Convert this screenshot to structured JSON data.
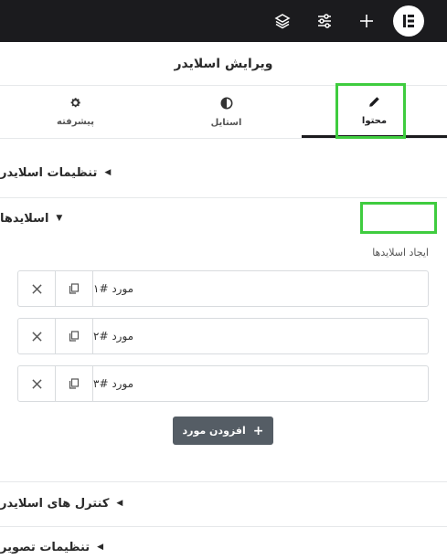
{
  "topbar": {
    "icons": [
      "layers-icon",
      "sliders-icon",
      "plus-icon",
      "elementor-logo-icon"
    ]
  },
  "panel": {
    "title": "ویرایش اسلایدر"
  },
  "tabs": [
    {
      "label": "محتوا",
      "icon": "pencil-icon",
      "active": true
    },
    {
      "label": "استایل",
      "icon": "half-circle-icon",
      "active": false
    },
    {
      "label": "پیشرفته",
      "icon": "gear-icon",
      "active": false
    }
  ],
  "sections": {
    "slider_settings": "تنظیمات اسلایدر",
    "slides": "اسلایدها",
    "slider_controls": "کنترل های اسلایدر",
    "image_settings": "تنظیمات تصویر"
  },
  "repeater": {
    "label": "ایجاد اسلایدها",
    "items": [
      {
        "title": "مورد #۱"
      },
      {
        "title": "مورد #۲"
      },
      {
        "title": "مورد #۳"
      }
    ],
    "add_label": "افزودن مورد"
  },
  "highlight_color": "#3fcc3f"
}
